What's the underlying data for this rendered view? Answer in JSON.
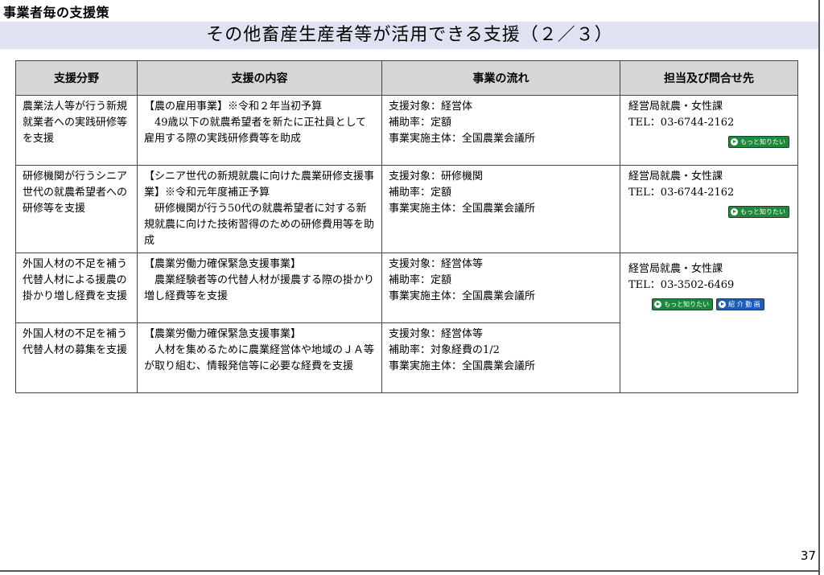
{
  "header": {
    "section_title": "事業者毎の支援策",
    "slide_title": "その他畜産生産者等が活用できる支援（２／３）"
  },
  "table": {
    "columns": [
      "支援分野",
      "支援の内容",
      "事業の流れ",
      "担当及び問合せ先"
    ],
    "rows": [
      {
        "field": "農業法人等が行う新規就業者への実践研修等を支援",
        "content_title": "【農の雇用事業】※令和２年当初予算",
        "content_body": "　49歳以下の就農希望者を新たに正社員として雇用する際の実践研修費等を助成",
        "flow": [
          "支援対象：経営体",
          "補助率：定額",
          "事業実施主体：全国農業会議所"
        ],
        "dept": "経営局就農・女性課",
        "tel": "TEL：03-6744-2162",
        "buttons": [
          "もっと知りたい"
        ]
      },
      {
        "field": "研修機関が行うシニア世代の就農希望者への研修等を支援",
        "content_title": "【シニア世代の新規就農に向けた農業研修支援事業】※令和元年度補正予算",
        "content_body": "　研修機関が行う50代の就農希望者に対する新規就農に向けた技術習得のための研修費用等を助成",
        "flow": [
          "支援対象：研修機関",
          "補助率：定額",
          "事業実施主体：全国農業会議所"
        ],
        "dept": "経営局就農・女性課",
        "tel": "TEL：03-6744-2162",
        "buttons": [
          "もっと知りたい"
        ]
      },
      {
        "field": "外国人材の不足を補う代替人材による援農の掛かり増し経費を支援",
        "content_title": "【農業労働力確保緊急支援事業】",
        "content_body": "　農業経験者等の代替人材が援農する際の掛かり増し経費等を支援",
        "flow": [
          "支援対象：経営体等",
          "補助率：定額",
          "事業実施主体：全国農業会議所"
        ],
        "dept": "経営局就農・女性課",
        "tel": "TEL：03-3502-6469",
        "buttons": [
          "もっと知りたい",
          "紹 介 動 画"
        ]
      },
      {
        "field": "外国人材の不足を補う代替人材の募集を支援",
        "content_title": "【農業労働力確保緊急支援事業】",
        "content_body": "　人材を集めるために農業経営体や地域のＪＡ等が取り組む、情報発信等に必要な経費を支援",
        "flow": [
          "支援対象：経営体等",
          "補助率：対象経費の1/2",
          "事業実施主体：全国農業会議所"
        ]
      }
    ]
  },
  "footer": {
    "page_number": "37"
  },
  "colors": {
    "title_band": "#dfe3f1",
    "header_cell": "#d6d6d6",
    "button_green": "#1b8a3a",
    "button_blue": "#1d5db5"
  }
}
